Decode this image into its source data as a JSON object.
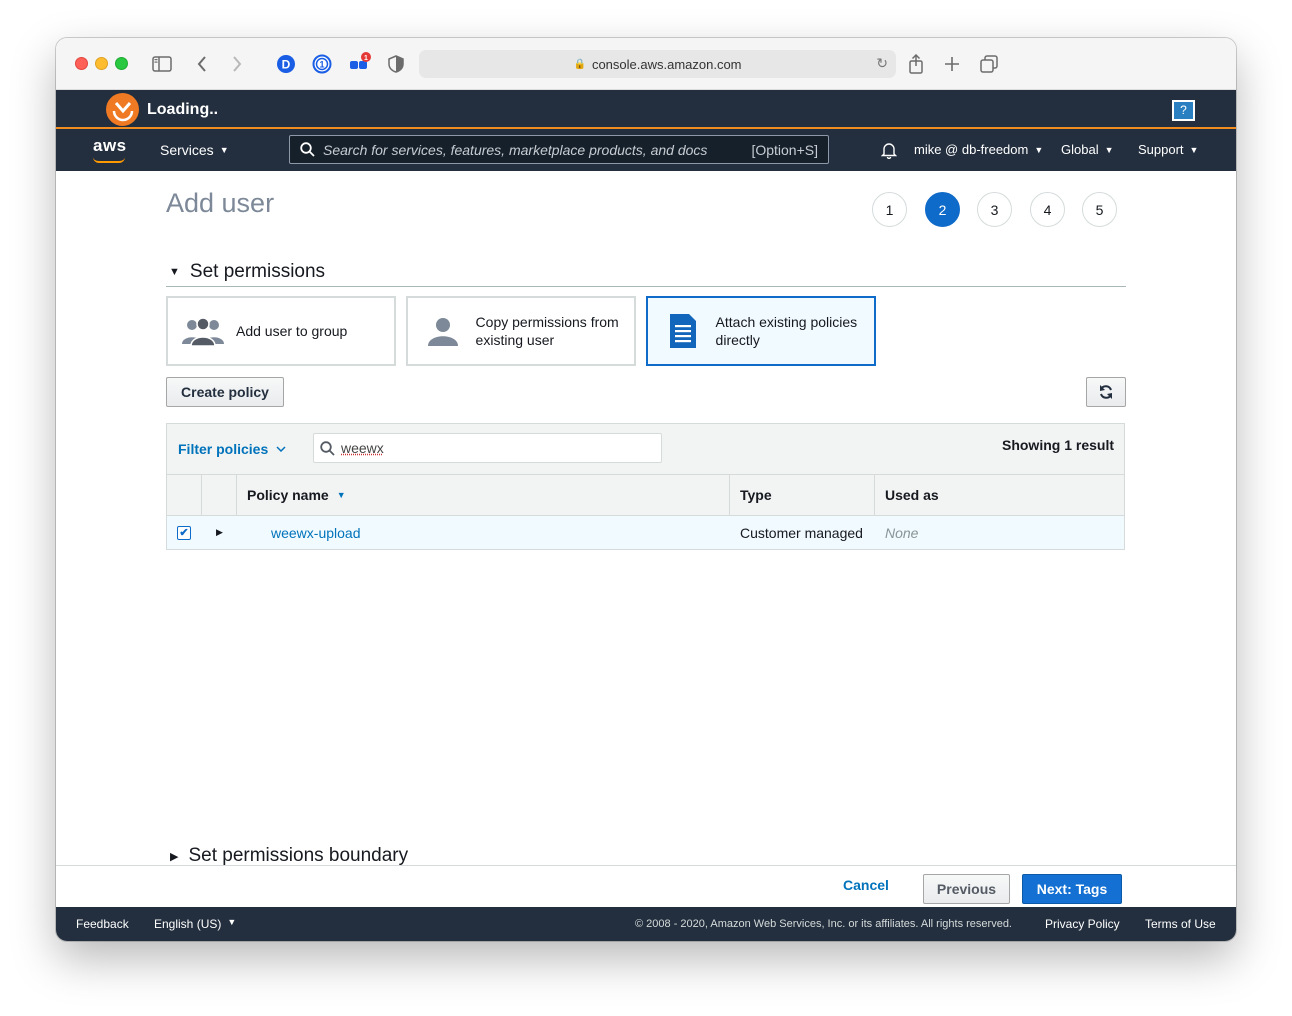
{
  "browser": {
    "url": "console.aws.amazon.com",
    "extension_badge": "1",
    "ext_d_label": "D",
    "ext_onepw_label": "1"
  },
  "extension_bar": {
    "loading_text": "Loading..",
    "help_label": "?"
  },
  "navbar": {
    "logo_text": "aws",
    "services_label": "Services",
    "search_placeholder": "Search for services, features, marketplace products, and docs",
    "search_shortcut": "[Option+S]",
    "account_label": "mike @ db-freedom",
    "region_label": "Global",
    "support_label": "Support"
  },
  "page": {
    "title": "Add user",
    "steps": [
      "1",
      "2",
      "3",
      "4",
      "5"
    ],
    "active_step": "2",
    "section_title": "Set permissions",
    "options": [
      {
        "label": "Add user to group"
      },
      {
        "label": "Copy permissions from existing user"
      },
      {
        "label": "Attach existing policies directly"
      }
    ],
    "create_policy_label": "Create policy",
    "filter": {
      "label": "Filter policies",
      "value": "weewx",
      "result_text": "Showing 1 result"
    },
    "table": {
      "headers": [
        "Policy name",
        "Type",
        "Used as"
      ],
      "rows": [
        {
          "checked": true,
          "name": "weewx-upload",
          "type": "Customer managed",
          "used_as": "None"
        }
      ]
    },
    "boundary_title": "Set permissions boundary"
  },
  "actions": {
    "cancel": "Cancel",
    "previous": "Previous",
    "next": "Next: Tags"
  },
  "footer": {
    "feedback": "Feedback",
    "language": "English (US)",
    "copyright": "© 2008 - 2020, Amazon Web Services, Inc. or its affiliates. All rights reserved.",
    "privacy": "Privacy Policy",
    "terms": "Terms of Use"
  },
  "colors": {
    "aws_dark": "#232f3e",
    "accent_orange": "#f08c20",
    "primary_blue": "#1471d3",
    "link_blue": "#0073bb"
  }
}
